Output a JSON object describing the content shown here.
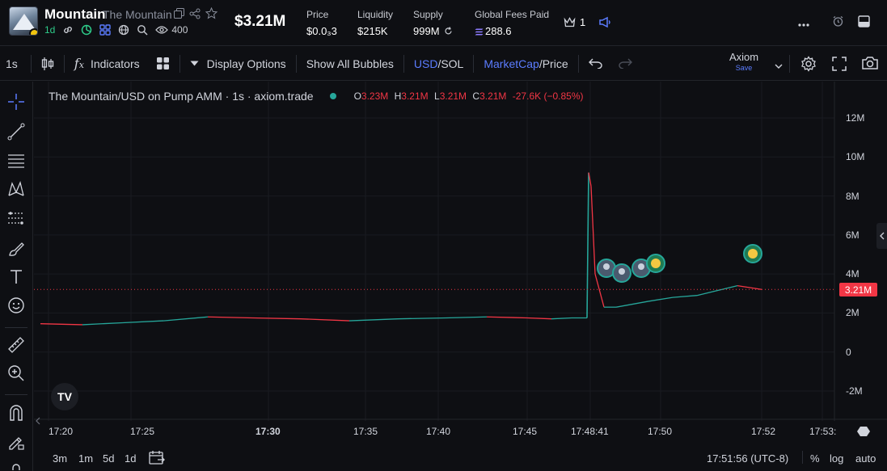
{
  "header": {
    "token_name": "Mountain",
    "token_full_name": "The Mountain",
    "age": "1d",
    "watchers": "400",
    "market_cap": "$3.21M",
    "stats": [
      {
        "label": "Price",
        "value": "$0.0₃3"
      },
      {
        "label": "Liquidity",
        "value": "$215K"
      },
      {
        "label": "Supply",
        "value": "999M"
      },
      {
        "label": "Global Fees Paid",
        "value": "288.6"
      }
    ],
    "crown_count": "1"
  },
  "toolbar": {
    "interval": "1s",
    "indicators": "Indicators",
    "display_options": "Display Options",
    "show_bubbles": "Show All Bubbles",
    "usd": "USD",
    "sol": "SOL",
    "slash": "/",
    "mcap": "MarketCap",
    "price": "Price",
    "layout_name": "Axiom",
    "layout_save": "Save"
  },
  "chart": {
    "legend_title": "The Mountain/USD on Pump AMM · 1s · axiom.trade",
    "ohlc": {
      "o_label": "O",
      "o": "3.23M",
      "h_label": "H",
      "h": "3.21M",
      "l_label": "L",
      "l": "3.21M",
      "c_label": "C",
      "c": "3.21M",
      "chg": "-27.6K (−0.85%)"
    },
    "current_price_tag": "3.21M",
    "colors": {
      "up": "#26a69a",
      "down": "#f23645",
      "bg": "#0e0f13",
      "accent": "#5b7cff"
    }
  },
  "chart_data": {
    "type": "line",
    "title": "The Mountain/USD on Pump AMM · 1s · axiom.trade",
    "y_ticks": [
      "12M",
      "10M",
      "8M",
      "6M",
      "4M",
      "2M",
      "0",
      "-2M"
    ],
    "x_ticks": [
      "17:20",
      "17:25",
      "17:30",
      "17:35",
      "17:40",
      "17:45",
      "17:48:41",
      "17:50",
      "17:52",
      "17:53:"
    ],
    "ylim": [
      -2.5,
      12.5
    ],
    "x": [
      "17:20",
      "17:22",
      "17:24",
      "17:26",
      "17:28",
      "17:30",
      "17:32",
      "17:34",
      "17:36",
      "17:38",
      "17:40",
      "17:42",
      "17:44",
      "17:46",
      "17:48",
      "17:48:41",
      "17:48:42",
      "17:48:45",
      "17:48:50",
      "17:49",
      "17:49:30",
      "17:50",
      "17:50:30",
      "17:51",
      "17:51:30",
      "17:51:56"
    ],
    "series": [
      {
        "values": [
          1.45,
          1.4,
          1.5,
          1.6,
          1.8,
          1.75,
          1.7,
          1.6,
          1.7,
          1.75,
          1.8,
          1.75,
          1.7,
          1.75,
          1.75,
          9.2,
          8.5,
          4.0,
          2.3,
          2.3,
          2.6,
          2.8,
          2.9,
          3.2,
          3.4,
          3.21
        ]
      }
    ],
    "current_value": 3.21,
    "grid": true
  },
  "bottom": {
    "ranges": [
      "3m",
      "1m",
      "5d",
      "1d"
    ],
    "clock": "17:51:56 (UTC-8)",
    "percent": "%",
    "log": "log",
    "auto": "auto"
  }
}
